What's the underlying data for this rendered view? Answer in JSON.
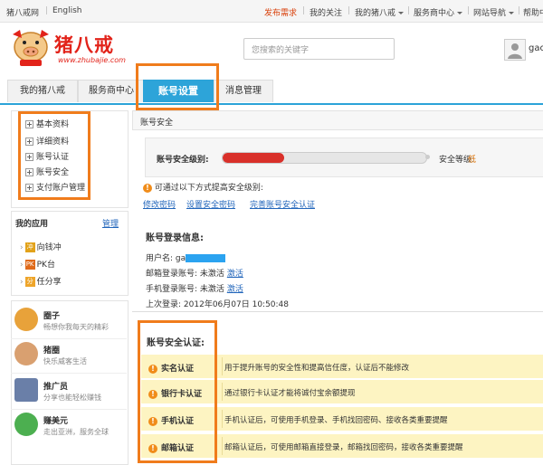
{
  "topbar": {
    "site_name": "猪八戒网",
    "language": "English",
    "post_demand": "发布需求",
    "my_follow": "我的关注",
    "my_zbj": "我的猪八戒",
    "provider_center": "服务商中心",
    "site_nav": "网站导航",
    "help": "帮助中"
  },
  "header": {
    "logo_text": "猪八戒",
    "logo_url": "www.zhubajie.com",
    "search_placeholder": "您搜索的关键字",
    "username": "gac"
  },
  "tabs": [
    {
      "label": "我的猪八戒"
    },
    {
      "label": "服务商中心"
    },
    {
      "label": "账号设置"
    },
    {
      "label": "消息管理"
    }
  ],
  "sidebar": {
    "menu": [
      {
        "label": "基本资料"
      },
      {
        "label": "详细资料"
      },
      {
        "label": "账号认证"
      },
      {
        "label": "账号安全"
      },
      {
        "label": "支付账户管理"
      }
    ],
    "apps_title": "我的应用",
    "apps_manage": "管理",
    "apps": [
      {
        "icon": "冲",
        "label": "向钱冲"
      },
      {
        "icon": "PK",
        "label": "PK台"
      },
      {
        "icon": "分",
        "label": "任分享"
      }
    ],
    "promos": [
      {
        "title": "圈子",
        "subtitle": "畅想你我每天的精彩",
        "color": "#e8a23a"
      },
      {
        "title": "猪圈",
        "subtitle": "快乐威客生活",
        "color": "#d9a070"
      },
      {
        "title": "推广员",
        "subtitle": "分享也能轻松赚钱",
        "color": "#6a7fa8"
      },
      {
        "title": "赚美元",
        "subtitle": "走出亚洲，服务全球",
        "color": "#4caf50"
      }
    ]
  },
  "main": {
    "section_title": "账号安全",
    "security_level_label": "账号安全级别:",
    "security_level_text": "安全等级:",
    "security_level_value": "低",
    "security_level_fraction": 0.3,
    "tip": "可通过以下方式提高安全级别:",
    "links": [
      "修改密码",
      "设置安全密码",
      "完善账号安全认证"
    ],
    "login_title": "账号登录信息:",
    "username_label": "用户名:",
    "username_value": "ga",
    "email_label": "邮箱登录账号:",
    "email_status": "未激活",
    "email_action": "激活",
    "mobile_label": "手机登录账号:",
    "mobile_status": "未激活",
    "mobile_action": "激活",
    "last_login_label": "上次登录:",
    "last_login_value": "2012年06月07日 10:50:48",
    "auth_title": "账号安全认证:",
    "auth_items": [
      {
        "name": "实名认证",
        "desc": "用于提升账号的安全性和提高信任度，认证后不能修改"
      },
      {
        "name": "银行卡认证",
        "desc": "通过银行卡认证才能将诚付宝余额提现"
      },
      {
        "name": "手机认证",
        "desc": "手机认证后，可使用手机登录、手机找回密码、接收各类重要提醒"
      },
      {
        "name": "邮箱认证",
        "desc": "邮箱认证后，可使用邮箱直接登录，邮箱找回密码，接收各类重要提醒"
      }
    ]
  },
  "colors": {
    "accent": "#2da4d9",
    "highlight": "#f07c1c",
    "level_bar": "#d9302a",
    "auth_bg": "#fdf4c2"
  }
}
